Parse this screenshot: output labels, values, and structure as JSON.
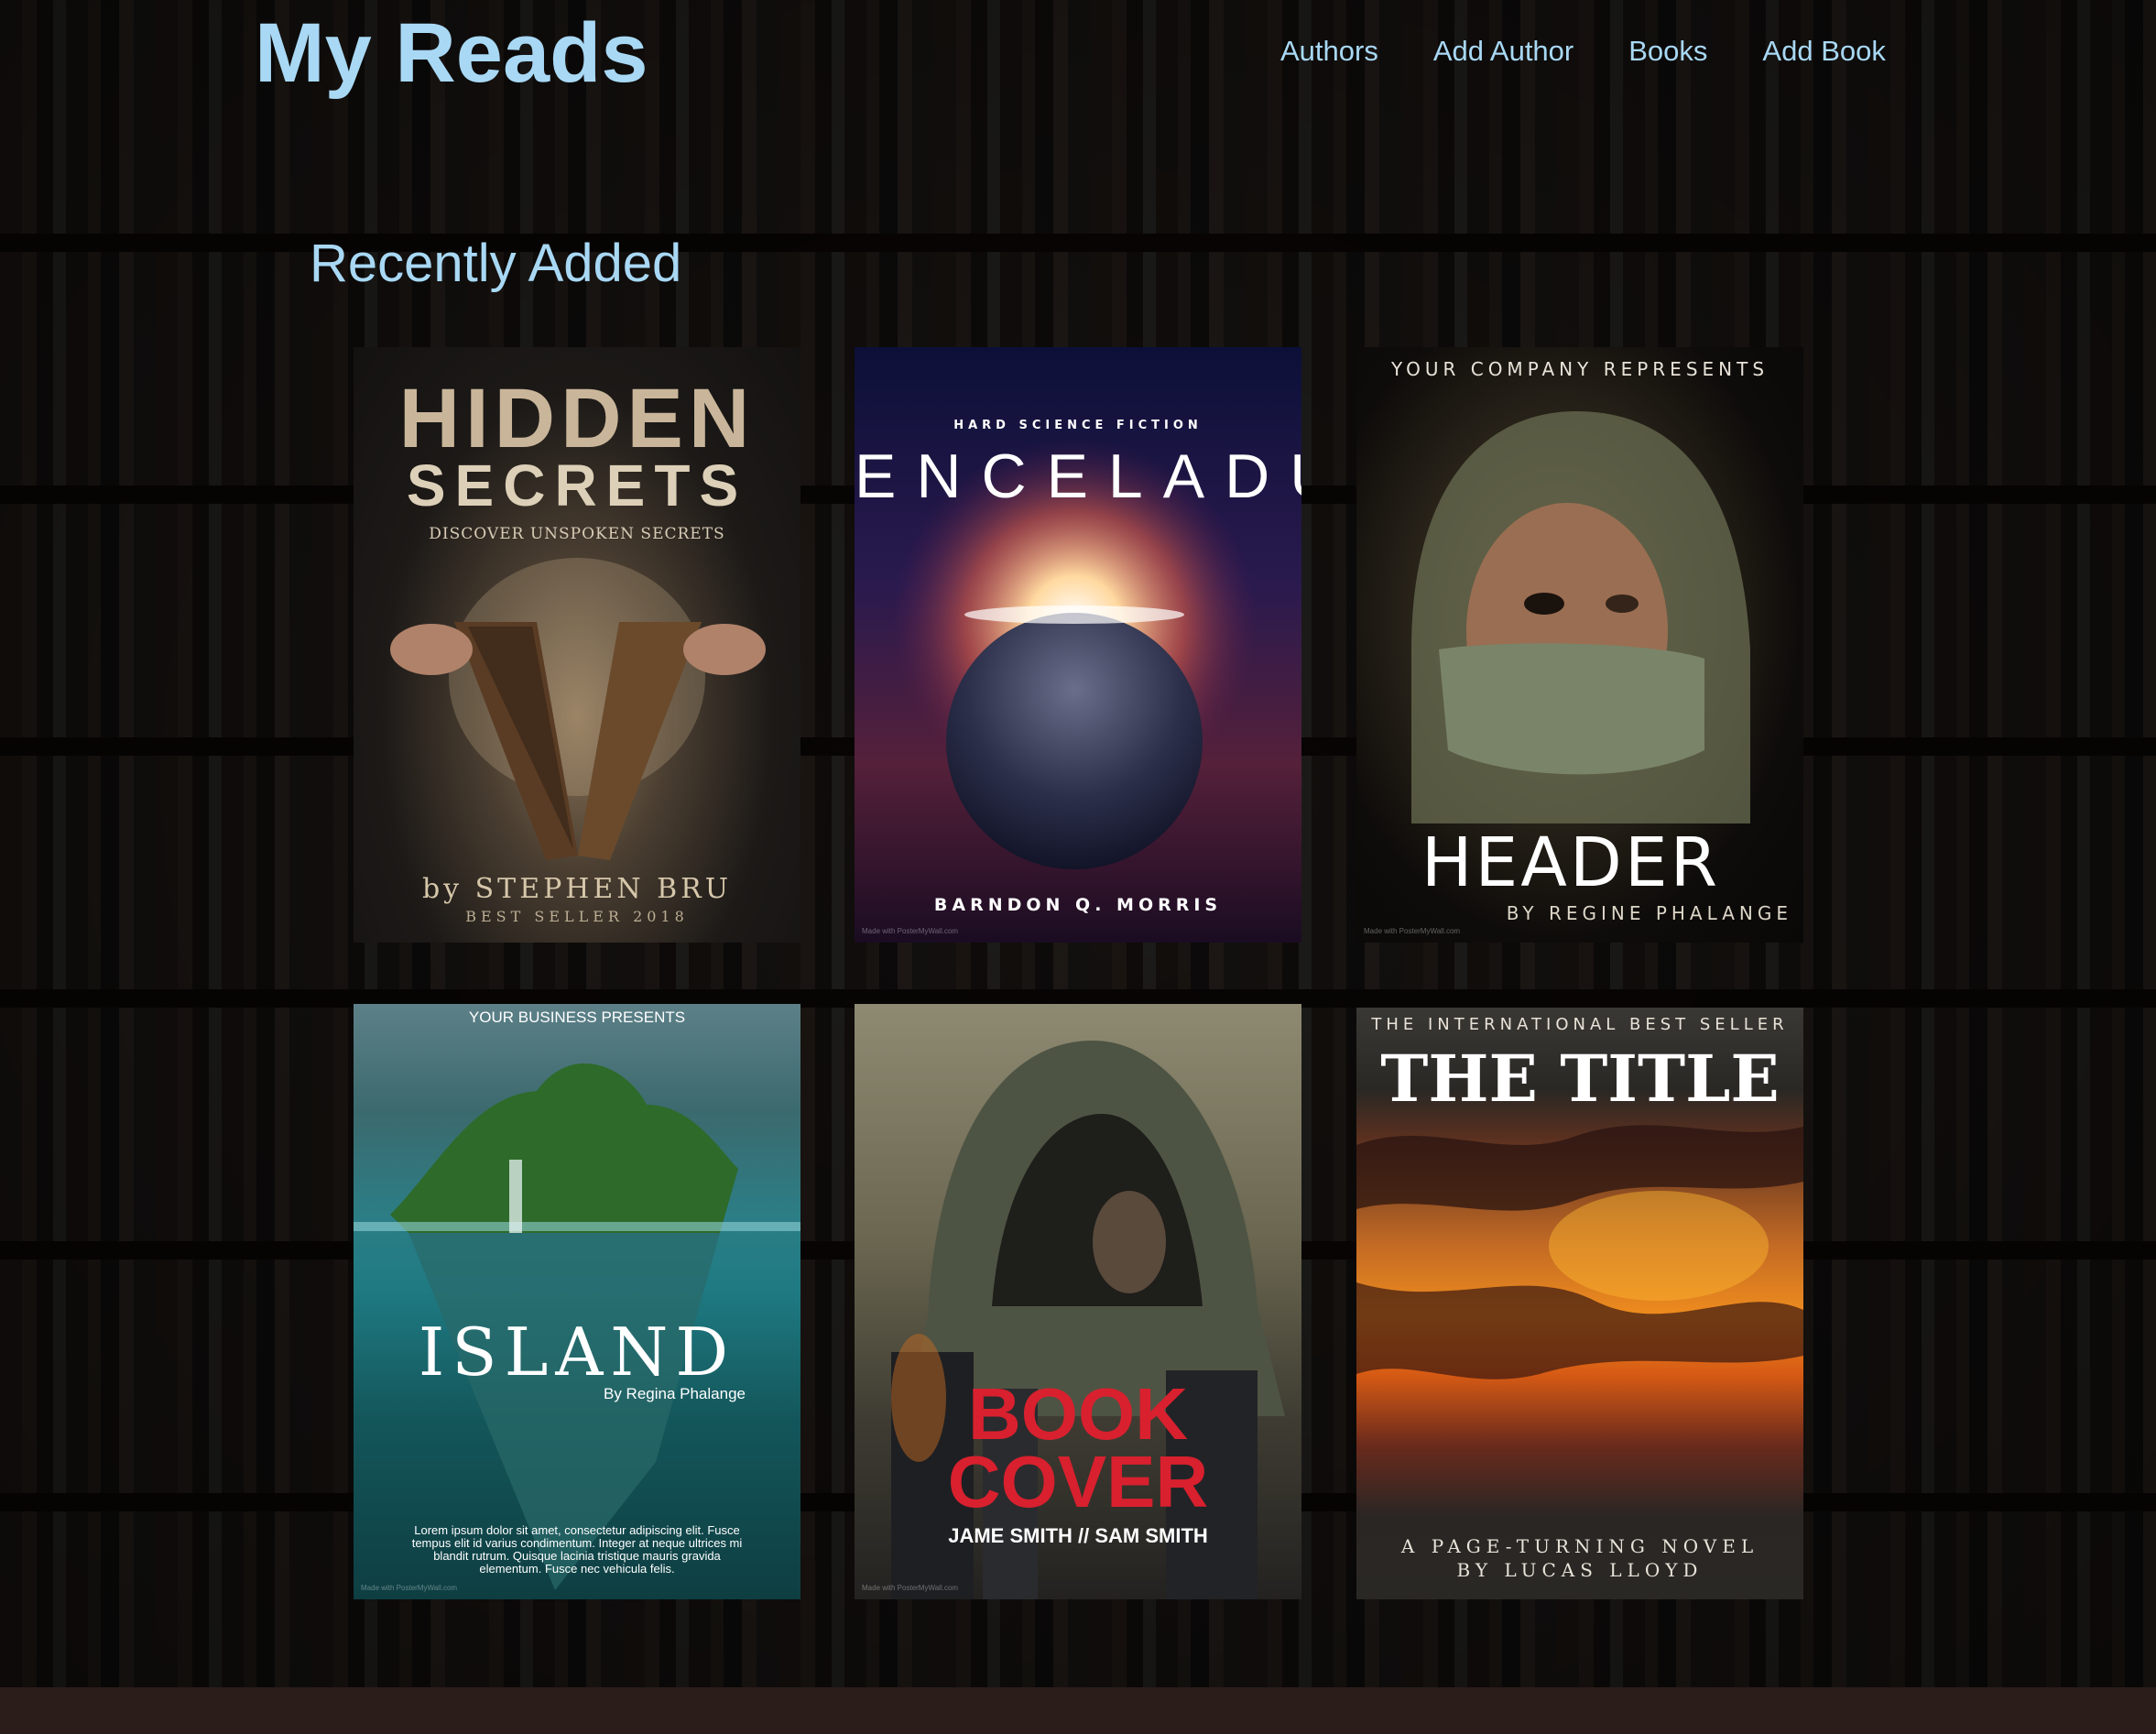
{
  "header": {
    "logo": "My Reads",
    "nav": [
      "Authors",
      "Add Author",
      "Books",
      "Add Book"
    ]
  },
  "section": {
    "title": "Recently Added"
  },
  "books": [
    {
      "title_line1": "HIDDEN",
      "title_line2": "SECRETS",
      "tagline": "DISCOVER UNSPOKEN SECRETS",
      "author": "by STEPHEN BRU",
      "footer": "BEST SELLER 2018"
    },
    {
      "genre": "HARD SCIENCE FICTION",
      "title": "ENCELADUS",
      "author": "BARNDON Q. MORRIS",
      "watermark": "Made with PosterMyWall.com"
    },
    {
      "presenter": "YOUR COMPANY REPRESENTS",
      "title": "HEADER",
      "author": "BY REGINE PHALANGE",
      "watermark": "Made with PosterMyWall.com"
    },
    {
      "presenter": "YOUR BUSINESS PRESENTS",
      "title": "ISLAND",
      "author": "By Regina Phalange",
      "blurb": "Lorem ipsum dolor sit amet, consectetur adipiscing elit. Fusce tempus elit id varius condimentum. Integer at neque ultrices mi blandit rutrum. Quisque lacinia tristique mauris gravida elementum. Fusce nec vehicula felis.",
      "watermark": "Made with PosterMyWall.com"
    },
    {
      "title_line1": "BOOK",
      "title_line2": "COVER",
      "author": "JAME SMITH // SAM SMITH",
      "watermark": "Made with PosterMyWall.com"
    },
    {
      "tagline": "THE INTERNATIONAL BEST SELLER",
      "title": "THE TITLE",
      "subtitle_line1": "A PAGE-TURNING NOVEL",
      "subtitle_line2": "BY LUCAS LLOYD"
    }
  ]
}
